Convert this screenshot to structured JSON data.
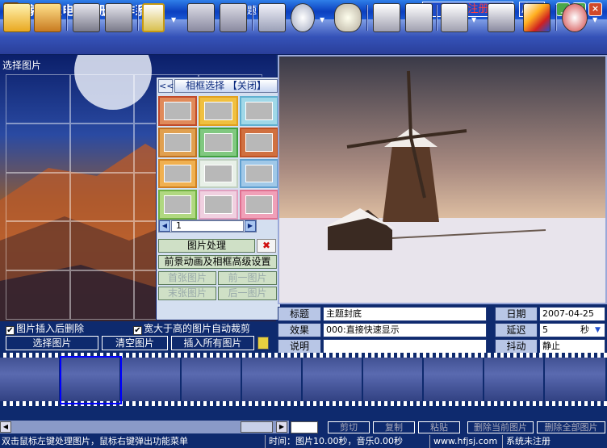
{
  "app": {
    "title": "家家乐电子相册制作系统",
    "theme_label": "【『主题：』】",
    "register_label": "用户注册",
    "skin_label": "皮肤",
    "min_glyph": "_",
    "max_glyph": "□",
    "close_glyph": "×"
  },
  "toolbar": {
    "icons": [
      "album-icon",
      "photo-frame-icon",
      "save-icon",
      "save-all-icon",
      "frame-dropdown-icon",
      "document-icon",
      "delete-icon",
      "edit-image-icon",
      "effects-dropdown-icon",
      "music-icon",
      "import-icon",
      "layers-icon",
      "screen-dropdown-icon",
      "print-icon",
      "palette-icon",
      "clock-dropdown-icon"
    ]
  },
  "left_panel": {
    "label": "选择图片",
    "scroll_glyph": "▼"
  },
  "frame_popup": {
    "prev_glyph": "<<",
    "title": "相框选择 【关闭】",
    "page": "1",
    "left_glyph": "◀",
    "right_glyph": "▶",
    "process_label": "图片处理",
    "close_glyph": "✖",
    "advanced_label": "前景动画及相框高级设置",
    "first_label": "首张图片",
    "prev_label": "前一图片",
    "last_label": "末张图片",
    "next_label": "后一图片"
  },
  "options": {
    "delete_after_insert": "图片插入后删除",
    "auto_crop": "宽大于高的图片自动裁剪",
    "check_mark": "✔"
  },
  "actions": {
    "select": "选择图片",
    "clear": "清空图片",
    "insert_all": "插入所有图片"
  },
  "info": {
    "title_label": "标题",
    "title_value": "主题封底",
    "effect_label": "效果",
    "effect_value": "000:直接快速显示",
    "desc_label": "说明",
    "date_label": "日期",
    "date_value": "2007-04-25",
    "delay_label": "延迟",
    "delay_value": "5",
    "delay_unit": "秒",
    "shake_label": "抖动",
    "shake_value": "静止"
  },
  "bottom": {
    "cut": "剪切",
    "copy": "复制",
    "paste": "粘贴",
    "delete_current": "删除当前图片",
    "delete_all": "删除全部图片"
  },
  "status": {
    "hint": "双击鼠标左键处理图片，鼠标右键弹出功能菜单",
    "time": "时间：图片10.00秒，音乐0.00秒",
    "site": "www.hfjsj.com",
    "reg": "系统未注册"
  },
  "colors": {
    "accent": "#0e2a6e",
    "register": "#ff4040"
  }
}
